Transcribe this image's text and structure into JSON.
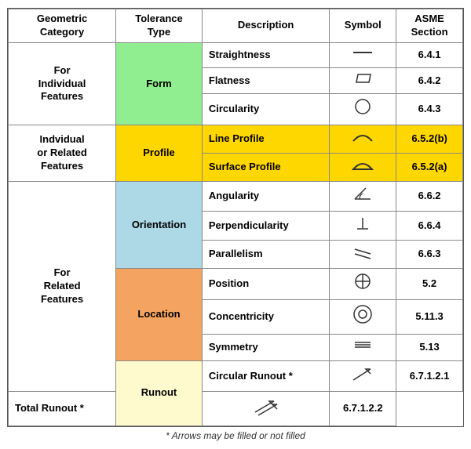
{
  "header": {
    "col1": "Geometric\nCategory",
    "col2": "Tolerance\nType",
    "col3": "Description",
    "col4": "Symbol",
    "col5": "ASME\nSection"
  },
  "rows": [
    {
      "category": "For\nIndividual\nFeatures",
      "category_rowspan": 3,
      "tolerance": "Form",
      "tolerance_class": "tol-form",
      "tolerance_rowspan": 3,
      "items": [
        {
          "desc": "Straightness",
          "symbol": "line",
          "asme": "6.4.1",
          "highlight": false
        },
        {
          "desc": "Flatness",
          "symbol": "parallelogram",
          "asme": "6.4.2",
          "highlight": false
        },
        {
          "desc": "Circularity",
          "symbol": "circle",
          "asme": "6.4.3",
          "highlight": false
        }
      ]
    },
    {
      "category": "Indvidual\nor Related\nFeatures",
      "category_rowspan": 2,
      "tolerance": "Profile",
      "tolerance_class": "tol-profile",
      "tolerance_rowspan": 2,
      "items": [
        {
          "desc": "Line Profile",
          "symbol": "arc-line",
          "asme": "6.5.2(b)",
          "highlight": true
        },
        {
          "desc": "Surface Profile",
          "symbol": "arc-surface",
          "asme": "6.5.2(a)",
          "highlight": true
        }
      ]
    },
    {
      "category": "For\nRelated\nFeatures",
      "category_rowspan": 7,
      "tolerance": "Orientation",
      "tolerance_class": "tol-orientation",
      "tolerance_rowspan": 3,
      "items": [
        {
          "desc": "Angularity",
          "symbol": "angularity",
          "asme": "6.6.2",
          "highlight": false
        },
        {
          "desc": "Perpendicularity",
          "symbol": "perpendicularity",
          "asme": "6.6.4",
          "highlight": false
        },
        {
          "desc": "Parallelism",
          "symbol": "parallelism",
          "asme": "6.6.3",
          "highlight": false
        }
      ]
    },
    {
      "category": null,
      "tolerance": "Location",
      "tolerance_class": "tol-location",
      "tolerance_rowspan": 3,
      "items": [
        {
          "desc": "Position",
          "symbol": "position",
          "asme": "5.2",
          "highlight": false
        },
        {
          "desc": "Concentricity",
          "symbol": "concentricity",
          "asme": "5.11.3",
          "highlight": false
        },
        {
          "desc": "Symmetry",
          "symbol": "symmetry",
          "asme": "5.13",
          "highlight": false
        }
      ]
    },
    {
      "category": null,
      "tolerance": "Runout",
      "tolerance_class": "tol-runout",
      "tolerance_rowspan": 2,
      "items": [
        {
          "desc": "Circular Runout *",
          "symbol": "runout-circular",
          "asme": "6.7.1.2.1",
          "highlight": false
        },
        {
          "desc": "Total Runout *",
          "symbol": "runout-total",
          "asme": "6.7.1.2.2",
          "highlight": false
        }
      ]
    }
  ],
  "footer": "* Arrows may be filled or not filled"
}
